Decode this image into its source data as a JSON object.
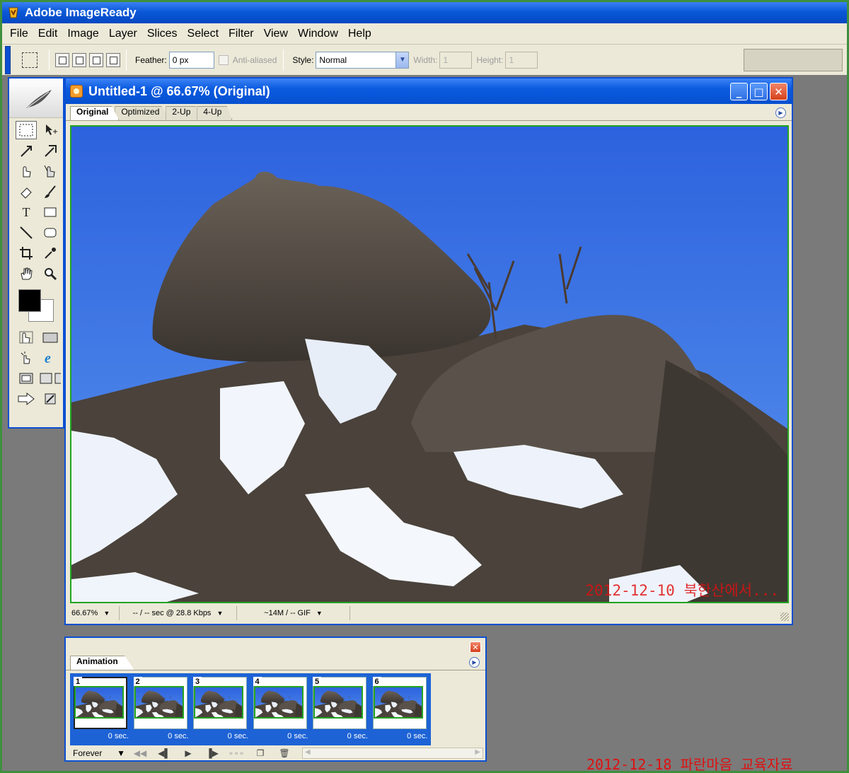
{
  "app": {
    "title": "Adobe ImageReady"
  },
  "menu": [
    "File",
    "Edit",
    "Image",
    "Layer",
    "Slices",
    "Select",
    "Filter",
    "View",
    "Window",
    "Help"
  ],
  "options": {
    "feather_label": "Feather:",
    "feather_value": "0 px",
    "antialiased_label": "Anti-aliased",
    "style_label": "Style:",
    "style_value": "Normal",
    "width_label": "Width:",
    "width_value": "1",
    "height_label": "Height:",
    "height_value": "1"
  },
  "toolbox": {
    "type_tool_glyph": "T",
    "tools": [
      "marquee-tool",
      "move-tool",
      "slice-tool",
      "slice-select-tool",
      "image-map-tool",
      "image-map-select-tool",
      "eraser-tool",
      "brush-tool",
      "type-tool",
      "rectangle-tool",
      "line-tool",
      "rounded-rectangle-tool",
      "crop-tool",
      "eyedropper-tool",
      "hand-tool",
      "zoom-tool"
    ],
    "foreground_color": "#000000",
    "background_color": "#ffffff"
  },
  "document": {
    "title": "Untitled-1 @ 66.67% (Original)",
    "tabs": [
      "Original",
      "Optimized",
      "2-Up",
      "4-Up"
    ],
    "active_tab": "Original",
    "photo_caption": "2012-12-10 북한산에서...",
    "status": {
      "zoom": "66.67%",
      "download": "-- / -- sec @ 28.8 Kbps",
      "size": "~14M / -- GIF"
    }
  },
  "animation": {
    "tab": "Animation",
    "frames": [
      {
        "num": "1",
        "delay": "0 sec."
      },
      {
        "num": "2",
        "delay": "0 sec."
      },
      {
        "num": "3",
        "delay": "0 sec."
      },
      {
        "num": "4",
        "delay": "0 sec."
      },
      {
        "num": "5",
        "delay": "0 sec."
      },
      {
        "num": "6",
        "delay": "0 sec."
      }
    ],
    "loop": "Forever"
  },
  "footer_caption": "2012-12-18 파란마음 교육자료",
  "colors": {
    "xp_blue": "#0a58d8",
    "selection_green": "#22a422",
    "caption_red": "#e01010"
  }
}
